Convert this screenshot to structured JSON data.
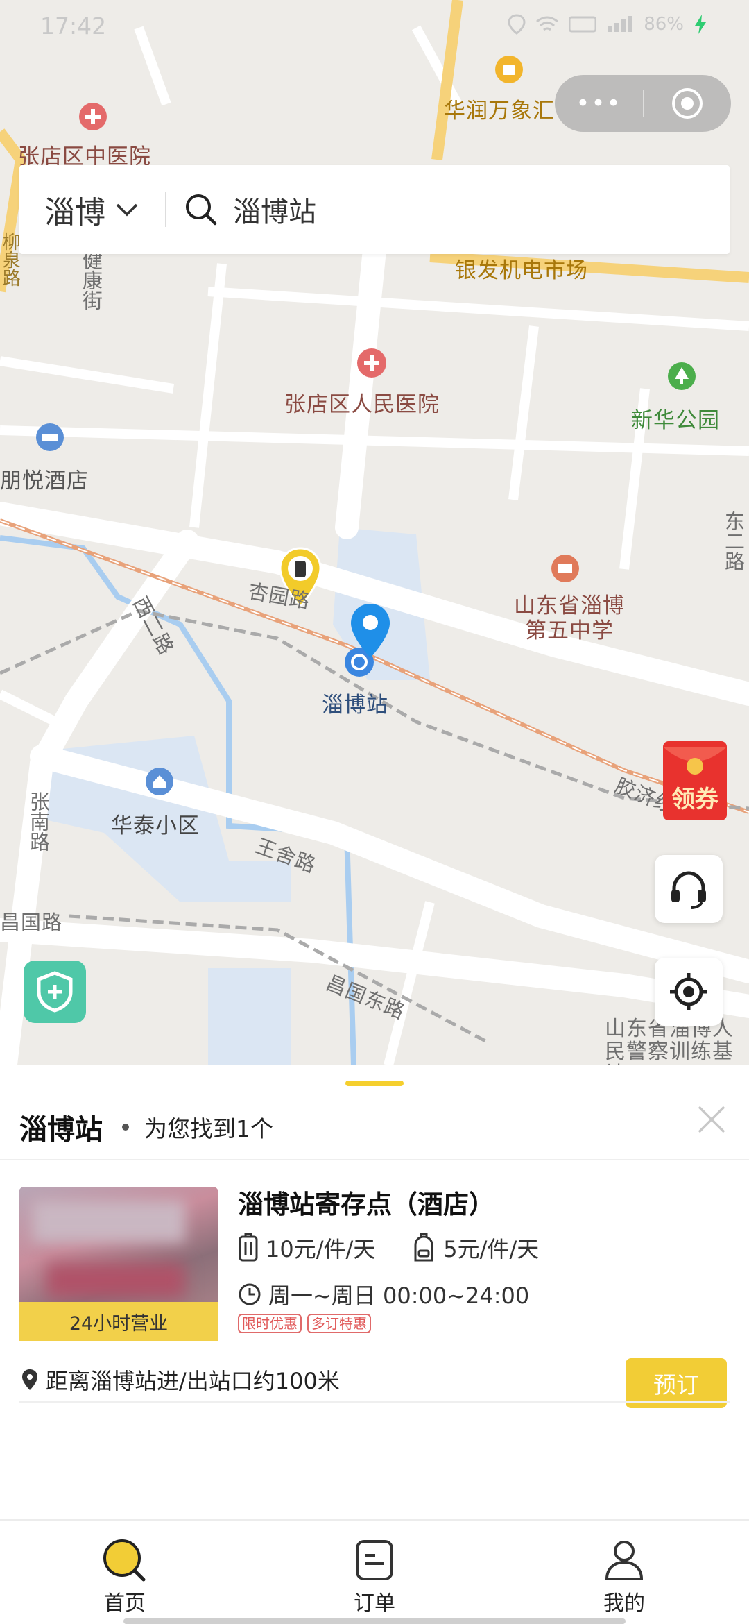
{
  "status_bar": {
    "time": "17:42",
    "battery": "86%"
  },
  "capsule": {
    "more_icon": "more-dots-icon",
    "close_icon": "target-circle-icon"
  },
  "search": {
    "city": "淄博",
    "query": "淄博站"
  },
  "map": {
    "labels": {
      "huarun": "华润万象汇",
      "tcm_hospital": "张店区中医院",
      "market": "银发机电市场",
      "jiankang": "健康街",
      "peoples_hospital": "张店区人民医院",
      "xinhua_park": "新华公园",
      "pengyue_hotel": "朋悦酒店",
      "dong_road": "东二路",
      "xingyuan_road": "杏园路",
      "xi_road": "西二路",
      "school": "山东省淄博第五中学",
      "station": "淄博站",
      "huatai": "华泰小区",
      "zhangnan": "张南路",
      "wangshe": "王舍路",
      "jiaoji": "胶济线",
      "changguo": "昌国路",
      "changguo_east": "昌国东路",
      "police": "山东省淄博人民警察训练基地",
      "left_vertical": "柳泉路"
    }
  },
  "floating": {
    "coupon": "领券"
  },
  "sheet": {
    "title": "淄博站",
    "found": "为您找到1个",
    "store": {
      "name": "淄博站寄存点（酒店）",
      "badge": "24小时营业",
      "price_large": "10元/件/天",
      "price_small": "5元/件/天",
      "hours": "周一~周日 00:00~24:00",
      "tags": [
        "限时优惠",
        "多订特惠"
      ],
      "distance": "距离淄博站进/出站口约100米",
      "book": "预订"
    }
  },
  "tabs": [
    {
      "label": "首页",
      "icon": "home-search-icon",
      "active": true
    },
    {
      "label": "订单",
      "icon": "order-icon",
      "active": false
    },
    {
      "label": "我的",
      "icon": "profile-icon",
      "active": false
    }
  ],
  "colors": {
    "accent": "#f2cd36",
    "map_bg": "#eeece8",
    "tag_red": "#e05858"
  }
}
